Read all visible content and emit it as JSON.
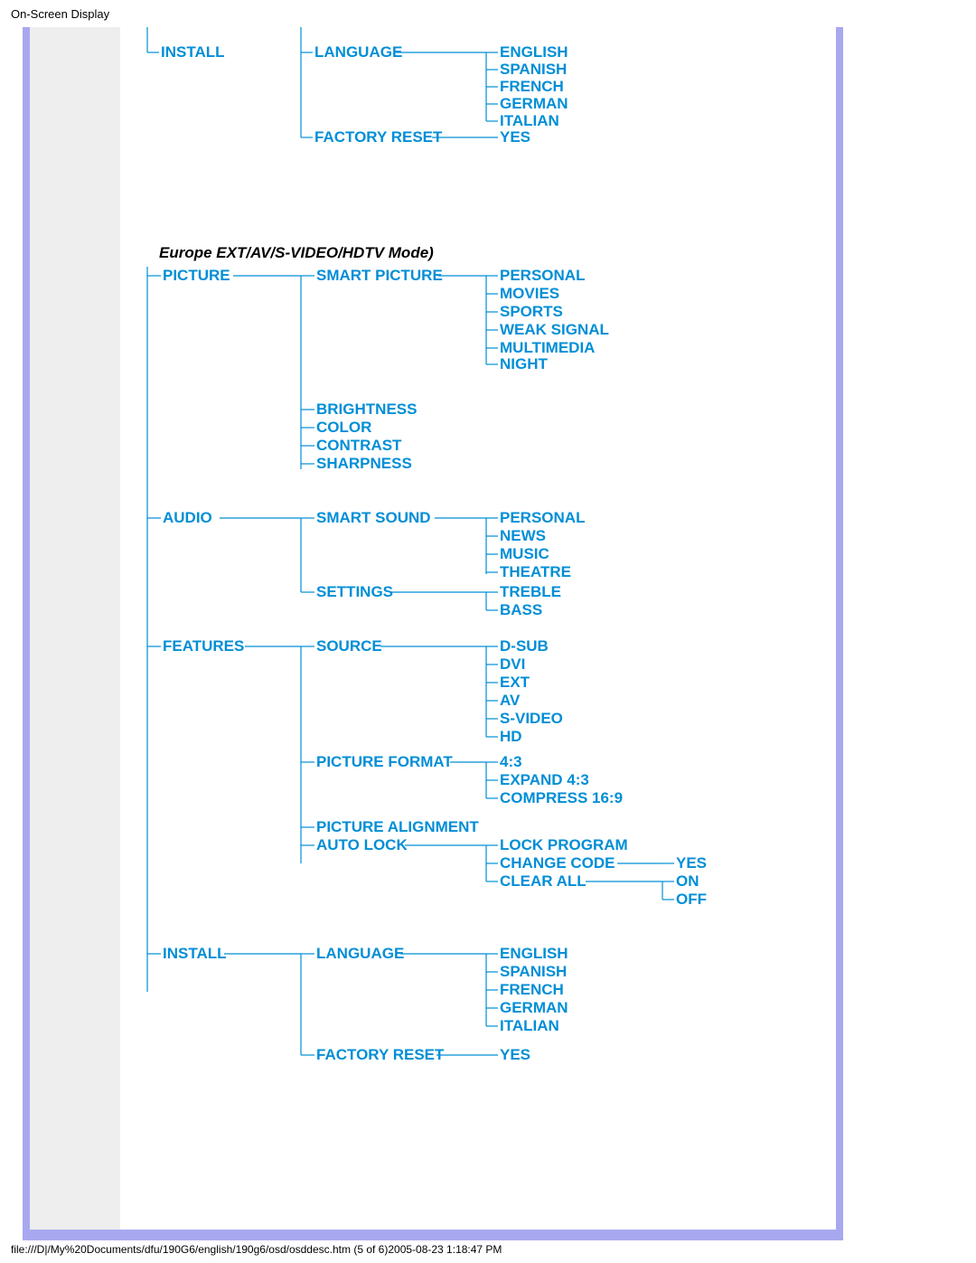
{
  "header": "On-Screen Display",
  "footer": "file:///D|/My%20Documents/dfu/190G6/english/190g6/osd/osddesc.htm (5 of 6)2005-08-23 1:18:47 PM",
  "top_tree": {
    "root": "INSTALL",
    "branches": [
      {
        "label": "LANGUAGE",
        "options": [
          "ENGLISH",
          "SPANISH",
          "FRENCH",
          "GERMAN",
          "ITALIAN"
        ]
      },
      {
        "label": "FACTORY RESET",
        "options": [
          "YES"
        ]
      }
    ]
  },
  "mode_title": "Europe EXT/AV/S-VIDEO/HDTV Mode)",
  "main_tree": [
    {
      "root": "PICTURE",
      "branches": [
        {
          "label": "SMART PICTURE",
          "options": [
            "PERSONAL",
            "MOVIES",
            "SPORTS",
            "WEAK SIGNAL",
            "MULTIMEDIA",
            "NIGHT"
          ]
        },
        {
          "label": "BRIGHTNESS"
        },
        {
          "label": "COLOR"
        },
        {
          "label": "CONTRAST"
        },
        {
          "label": "SHARPNESS"
        }
      ]
    },
    {
      "root": "AUDIO",
      "branches": [
        {
          "label": "SMART SOUND",
          "options": [
            "PERSONAL",
            "NEWS",
            "MUSIC",
            "THEATRE"
          ]
        },
        {
          "label": "SETTINGS",
          "options": [
            "TREBLE",
            "BASS"
          ]
        }
      ]
    },
    {
      "root": "FEATURES",
      "branches": [
        {
          "label": "SOURCE",
          "options": [
            "D-SUB",
            "DVI",
            "EXT",
            "AV",
            "S-VIDEO",
            "HD"
          ]
        },
        {
          "label": "PICTURE FORMAT",
          "options": [
            "4:3",
            "EXPAND 4:3",
            "COMPRESS 16:9"
          ]
        },
        {
          "label": "PICTURE ALIGNMENT"
        },
        {
          "label": "AUTO LOCK",
          "options": [
            "LOCK PROGRAM",
            "CHANGE CODE",
            "CLEAR ALL"
          ],
          "sub": {
            "CHANGE CODE": [
              "YES"
            ],
            "CLEAR ALL": [
              "ON",
              "OFF"
            ]
          }
        }
      ]
    },
    {
      "root": "INSTALL",
      "branches": [
        {
          "label": "LANGUAGE",
          "options": [
            "ENGLISH",
            "SPANISH",
            "FRENCH",
            "GERMAN",
            "ITALIAN"
          ]
        },
        {
          "label": "FACTORY RESET",
          "options": [
            "YES"
          ]
        }
      ]
    }
  ]
}
